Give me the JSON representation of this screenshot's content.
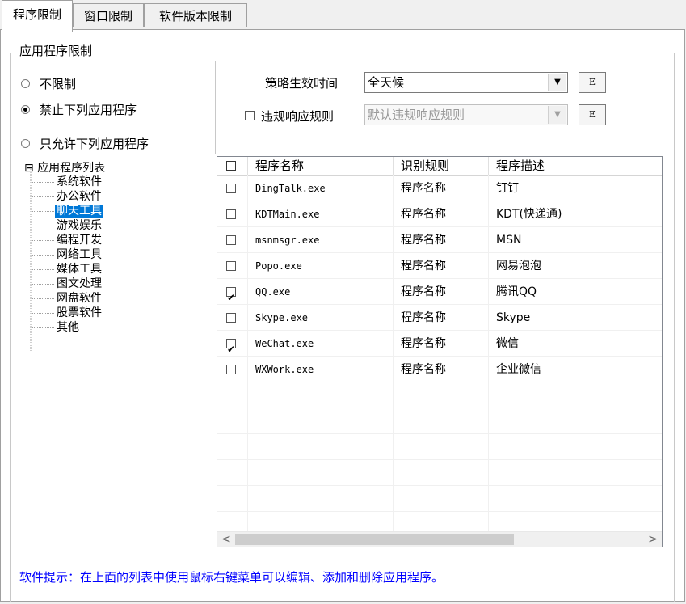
{
  "tabs": [
    {
      "label": "程序限制",
      "active": true
    },
    {
      "label": "窗口限制",
      "active": false
    },
    {
      "label": "软件版本限制",
      "active": false
    }
  ],
  "group": {
    "label": "应用程序限制"
  },
  "radios": [
    {
      "label": "不限制",
      "checked": false
    },
    {
      "label": "禁止下列应用程序",
      "checked": true
    },
    {
      "label": "只允许下列应用程序",
      "checked": false
    }
  ],
  "policy": {
    "time_label": "策略生效时间",
    "time_value": "全天候",
    "e_button": "E",
    "violation_label": "违规响应规则",
    "violation_checked": false,
    "violation_value": "默认违规响应规则",
    "violation_e_button": "E"
  },
  "tree": {
    "root": "应用程序列表",
    "root_toggle": "⊟",
    "children": [
      "系统软件",
      "办公软件",
      "聊天工具",
      "游戏娱乐",
      "编程开发",
      "网络工具",
      "媒体工具",
      "图文处理",
      "网盘软件",
      "股票软件",
      "其他"
    ],
    "selected": "聊天工具"
  },
  "table": {
    "headers": [
      "程序名称",
      "识别规则",
      "程序描述"
    ],
    "rows": [
      {
        "checked": false,
        "name": "DingTalk.exe",
        "rule": "程序名称",
        "desc": "钉钉"
      },
      {
        "checked": false,
        "name": "KDTMain.exe",
        "rule": "程序名称",
        "desc": "KDT(快递通)"
      },
      {
        "checked": false,
        "name": "msnmsgr.exe",
        "rule": "程序名称",
        "desc": "MSN"
      },
      {
        "checked": false,
        "name": "Popo.exe",
        "rule": "程序名称",
        "desc": "网易泡泡"
      },
      {
        "checked": true,
        "name": "QQ.exe",
        "rule": "程序名称",
        "desc": "腾讯QQ"
      },
      {
        "checked": false,
        "name": "Skype.exe",
        "rule": "程序名称",
        "desc": "Skype"
      },
      {
        "checked": true,
        "name": "WeChat.exe",
        "rule": "程序名称",
        "desc": "微信"
      },
      {
        "checked": false,
        "name": "WXWork.exe",
        "rule": "程序名称",
        "desc": "企业微信"
      }
    ],
    "scroll_left": "<",
    "scroll_right": ">"
  },
  "hint": "软件提示：在上面的列表中使用鼠标右键菜单可以编辑、添加和删除应用程序。",
  "colors": {
    "selection": "#0078d7",
    "hint": "#0000ff"
  }
}
